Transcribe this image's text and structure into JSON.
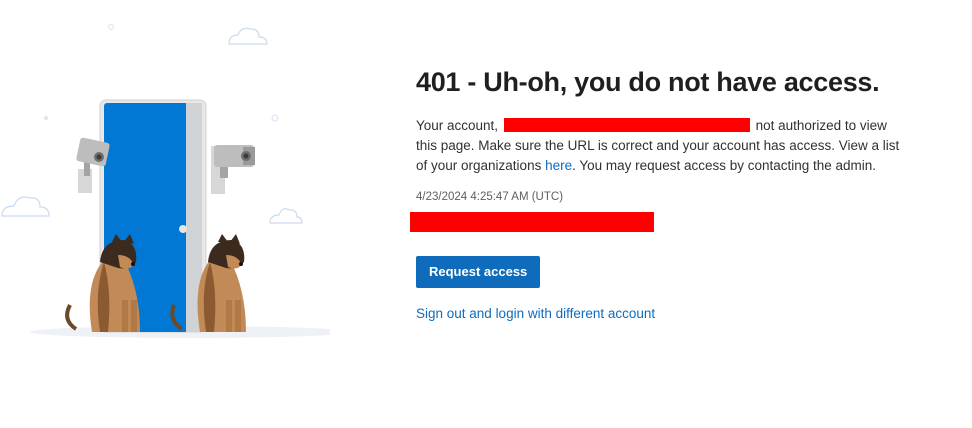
{
  "page": {
    "title": "401 - Uh-oh, you do not have access.",
    "message": {
      "prefix": "Your account,",
      "suffix": "not authorized to view this page. Make sure the URL is correct and your account has access. View a list of your organizations",
      "link_text": "here",
      "end": ". You may request access by contacting the admin."
    },
    "timestamp": "4/23/2024 4:25:47 AM (UTC)",
    "request_button": "Request access",
    "signout_link": "Sign out and login with different account"
  },
  "colors": {
    "accent": "#0f6cbd",
    "redaction": "#ff0000",
    "door": "#0078d4"
  }
}
